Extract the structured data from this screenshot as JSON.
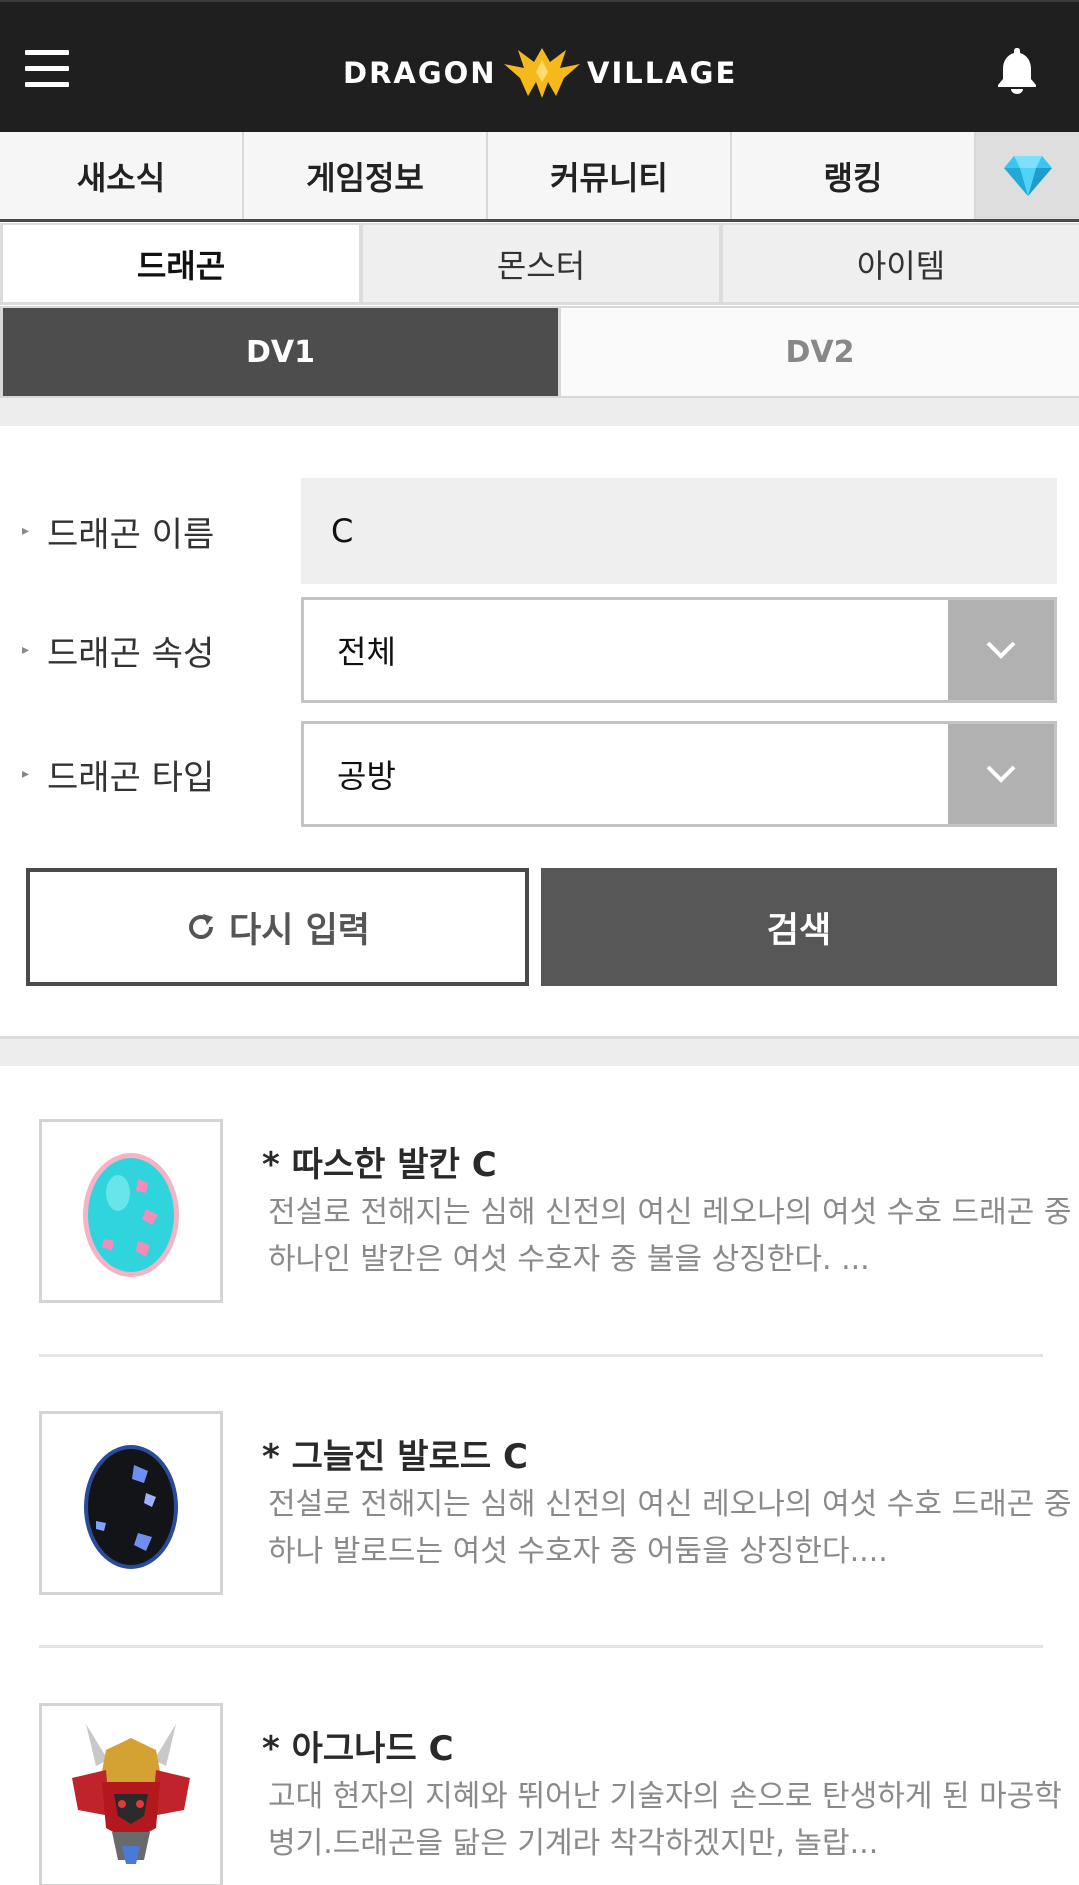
{
  "header": {
    "logo_left": "DRAGON",
    "logo_right": "VILLAGE",
    "brand_colors": {
      "bar": "#1f1f1f",
      "emblem": "#f5b91c"
    }
  },
  "main_nav": {
    "tabs": [
      {
        "label": "새소식"
      },
      {
        "label": "게임정보"
      },
      {
        "label": "커뮤니티"
      },
      {
        "label": "랭킹"
      }
    ],
    "gem_icon": "diamond-icon",
    "gem_color": "#37c7f2"
  },
  "sub_nav": {
    "tabs": [
      {
        "label": "드래곤",
        "active": true
      },
      {
        "label": "몬스터",
        "active": false
      },
      {
        "label": "아이템",
        "active": false
      }
    ]
  },
  "dv_tabs": {
    "tabs": [
      {
        "label": "DV1",
        "active": true
      },
      {
        "label": "DV2",
        "active": false
      }
    ]
  },
  "search_form": {
    "name_label": "드래곤 이름",
    "name_value": "C",
    "attribute_label": "드래곤 속성",
    "attribute_value": "전체",
    "type_label": "드래곤 타입",
    "type_value": "공방",
    "reset_label": "다시 입력",
    "search_label": "검색"
  },
  "results": [
    {
      "title": "* 따스한 발칸 C",
      "description": "전설로 전해지는 심해 신전의 여신 레오나의 여섯 수호 드래곤 중 하나인 발칸은 여섯 수호자 중 불을 상징한다. ...",
      "thumb_icon": "cyan-egg-icon"
    },
    {
      "title": "* 그늘진 발로드 C",
      "description": "전설로 전해지는 심해 신전의 여신 레오나의 여섯 수호 드래곤 중 하나 발로드는 여섯 수호자 중 어둠을 상징한다....",
      "thumb_icon": "black-egg-icon"
    },
    {
      "title": "* 아그나드 C",
      "description": "고대 현자의 지혜와 뛰어난 기술자의 손으로 탄생하게 된 마공학 병기.드래곤을 닮은 기계라 착각하겠지만, 놀랍...",
      "thumb_icon": "mecha-dragon-icon"
    }
  ]
}
